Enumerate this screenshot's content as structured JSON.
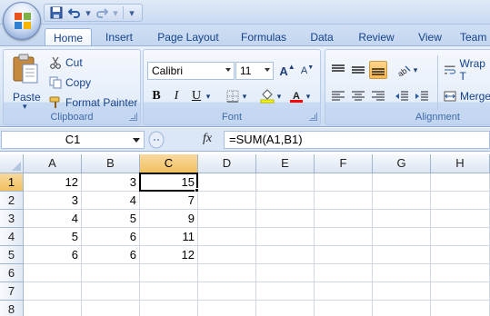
{
  "quick_access": {
    "save": "save-icon",
    "undo": "undo-icon",
    "redo": "redo-icon",
    "customize": "customize-qat-icon"
  },
  "tabs": [
    {
      "label": "Home",
      "active": true
    },
    {
      "label": "Insert"
    },
    {
      "label": "Page Layout"
    },
    {
      "label": "Formulas"
    },
    {
      "label": "Data"
    },
    {
      "label": "Review"
    },
    {
      "label": "View"
    },
    {
      "label": "Team"
    }
  ],
  "ribbon": {
    "clipboard": {
      "label": "Clipboard",
      "paste": "Paste",
      "cut": "Cut",
      "copy": "Copy",
      "format_painter": "Format Painter"
    },
    "font": {
      "label": "Font",
      "font_name": "Calibri",
      "font_size": "11",
      "bold": "B",
      "italic": "I",
      "underline": "U",
      "grow": "A",
      "shrink": "A",
      "fill_color": "#ffff00",
      "font_color": "#ff0000"
    },
    "alignment": {
      "label": "Alignment",
      "wrap_text": "Wrap T",
      "merge": "Merge"
    }
  },
  "formula_bar": {
    "name_box": "C1",
    "fx": "fx",
    "formula": "=SUM(A1,B1)"
  },
  "grid": {
    "columns": [
      "A",
      "B",
      "C",
      "D",
      "E",
      "F",
      "G",
      "H"
    ],
    "rows": [
      "1",
      "2",
      "3",
      "4",
      "5",
      "6",
      "7",
      "8"
    ],
    "selected_column": "C",
    "selected_row": "1",
    "cells": [
      [
        "12",
        "3",
        "15",
        "",
        "",
        "",
        "",
        ""
      ],
      [
        "3",
        "4",
        "7",
        "",
        "",
        "",
        "",
        ""
      ],
      [
        "4",
        "5",
        "9",
        "",
        "",
        "",
        "",
        ""
      ],
      [
        "5",
        "6",
        "11",
        "",
        "",
        "",
        "",
        ""
      ],
      [
        "6",
        "6",
        "12",
        "",
        "",
        "",
        "",
        ""
      ],
      [
        "",
        "",
        "",
        "",
        "",
        "",
        "",
        ""
      ],
      [
        "",
        "",
        "",
        "",
        "",
        "",
        "",
        ""
      ],
      [
        "",
        "",
        "",
        "",
        "",
        "",
        "",
        ""
      ]
    ]
  }
}
